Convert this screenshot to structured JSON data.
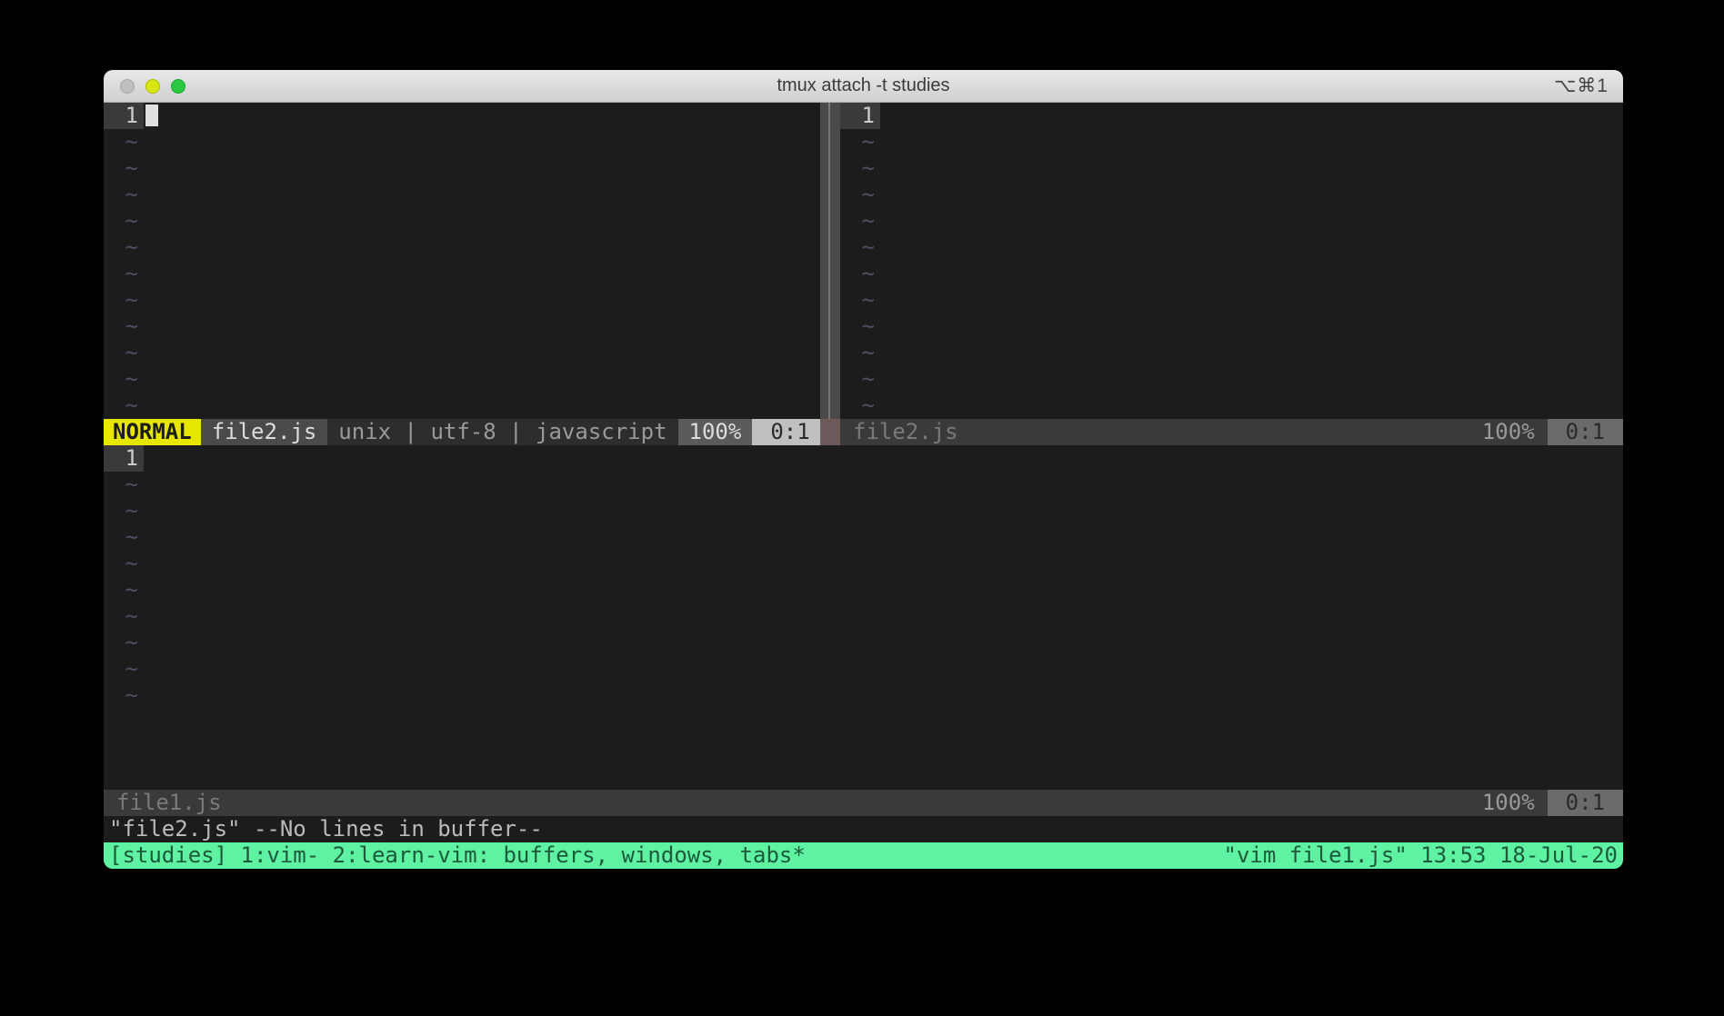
{
  "window": {
    "title": "tmux attach -t studies",
    "right_glyph": "⌥⌘1"
  },
  "vim": {
    "pane_top_left": {
      "line_number": "1",
      "tilde_rows": 11
    },
    "pane_top_right": {
      "line_number": "1",
      "tilde_rows": 11
    },
    "pane_bottom": {
      "line_number": "1",
      "tilde_rows": 9
    },
    "status_active": {
      "mode": "NORMAL",
      "file": "file2.js",
      "info": "unix | utf-8 | javascript",
      "percent": "100%",
      "pos": "0:1"
    },
    "status_top_right": {
      "file": "file2.js",
      "percent": "100%",
      "pos": "0:1"
    },
    "status_bottom": {
      "file": "file1.js",
      "percent": "100%",
      "pos": "0:1"
    },
    "cmdline": "\"file2.js\" --No lines in buffer--"
  },
  "tmux": {
    "left": "[studies] 1:vim- 2:learn-vim: buffers, windows, tabs*",
    "right": "\"vim file1.js\" 13:53 18-Jul-20"
  }
}
